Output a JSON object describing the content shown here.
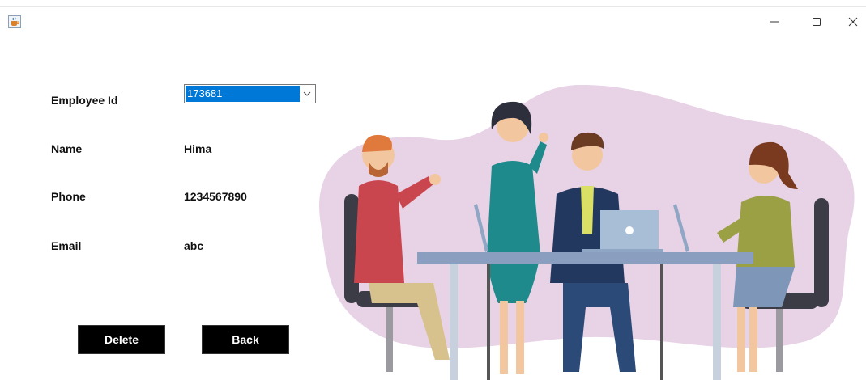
{
  "window": {
    "icon": "java-cup-icon",
    "controls": {
      "minimize": "minimize-icon",
      "maximize": "maximize-icon",
      "close": "close-icon"
    }
  },
  "form": {
    "employee_id_label": "Employee Id",
    "employee_id_value": "173681",
    "name_label": "Name",
    "name_value": "Hima",
    "phone_label": "Phone",
    "phone_value": "1234567890",
    "email_label": "Email",
    "email_value": "abc"
  },
  "buttons": {
    "delete_label": "Delete",
    "back_label": "Back"
  },
  "colors": {
    "selection": "#0078d7",
    "button_bg": "#000000",
    "blob": "#e8d2e6"
  }
}
